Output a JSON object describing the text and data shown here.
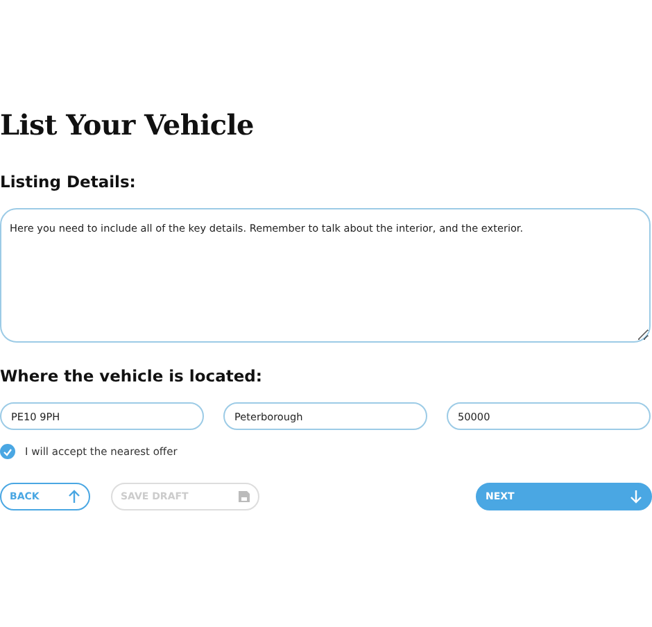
{
  "title": "List Your Vehicle",
  "details": {
    "label": "Listing Details:",
    "value": "Here you need to include all of the key details. Remember to talk about the interior, and the exterior."
  },
  "location": {
    "label": "Where the vehicle is located:",
    "fields": [
      {
        "value": "PE10 9PH"
      },
      {
        "value": "Peterborough"
      },
      {
        "value": "50000"
      }
    ]
  },
  "offer": {
    "label": "I will accept the nearest offer",
    "checked": true
  },
  "buttons": [
    {
      "kind": "back",
      "label": "BACK",
      "disabled": false
    },
    {
      "kind": "draft",
      "label": "SAVE DRAFT",
      "disabled": true
    },
    {
      "kind": "next",
      "label": "NEXT",
      "disabled": false
    }
  ]
}
